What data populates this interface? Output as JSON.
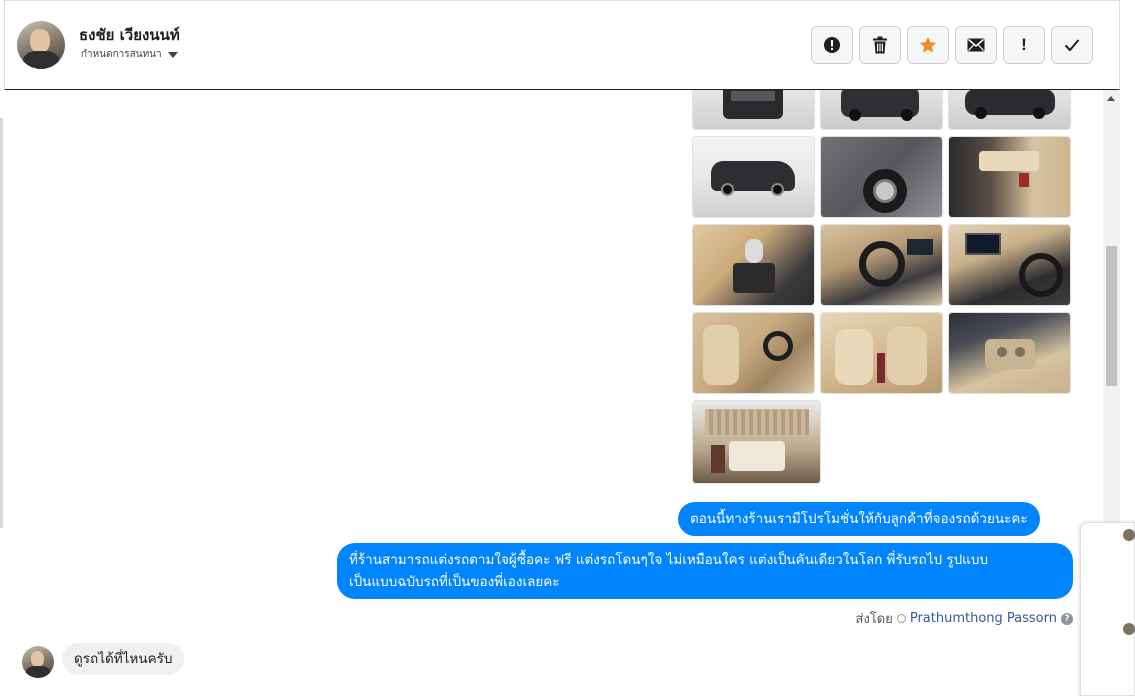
{
  "conversation": {
    "contact_name": "ธงชัย เวียงนนท์",
    "assign_label": "กำหนดการสนทนา"
  },
  "header_actions": [
    {
      "name": "report-button",
      "icon": "exclamation-circle-icon"
    },
    {
      "name": "delete-button",
      "icon": "trash-icon"
    },
    {
      "name": "star-button",
      "icon": "star-icon",
      "color": "#f28b1e"
    },
    {
      "name": "mark-unread-button",
      "icon": "envelope-icon"
    },
    {
      "name": "important-button",
      "icon": "exclamation-icon",
      "label": "!"
    },
    {
      "name": "done-button",
      "icon": "check-icon"
    }
  ],
  "photos": [
    {
      "label": "van-rear-partial"
    },
    {
      "label": "van-rear"
    },
    {
      "label": "van-rear-3q"
    },
    {
      "label": "van-side"
    },
    {
      "label": "van-wheel-closeup"
    },
    {
      "label": "door-interior"
    },
    {
      "label": "gear-shifter"
    },
    {
      "label": "dashboard-steering"
    },
    {
      "label": "console-screen"
    },
    {
      "label": "front-seats"
    },
    {
      "label": "captain-seats"
    },
    {
      "label": "seat-controls"
    },
    {
      "label": "rear-cabin"
    }
  ],
  "messages": {
    "out_1": "ตอนนี้ทางร้านเรามีโปรโมชั่นให้กับลูกค้าที่จองรถด้วยนะคะ",
    "out_2_line1": "ที่ร้านสามารถแต่งรถตามใจผู้ซื้อคะ ฟรี แต่งรถโดนๆใจ ไม่เหมือนใคร แต่งเป็นคันเดียวในโลก พี่รับรถไป รูปแบบ",
    "out_2_line2": "เป็นแบบฉบับรถที่เป็นของพี่เองเลยคะ",
    "sent_by_label": "ส่งโดย",
    "sent_by_name": "Prathumthong Passorn",
    "in_1": "ดูรถได้ที่ไหนครับ"
  },
  "colors": {
    "outgoing_bubble": "#0084ff",
    "incoming_bubble": "#f0f0f0",
    "star": "#f28b1e"
  }
}
